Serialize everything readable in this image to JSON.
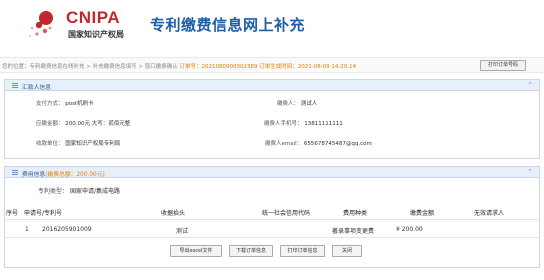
{
  "header": {
    "logo_brand": "CNIPA",
    "logo_sub": "国家知识产权局",
    "page_title": "专利缴费信息网上补充"
  },
  "breadcrumb": {
    "path": "您的位置：专利缴费信息在线补充 > 补充缴费信息填写 > 窗口缴费确认",
    "order_label": "订单号：2021080900302389",
    "time_label": "订单生成时间：2021-08-09 14:20:14",
    "print_order_button": "打印订单号码"
  },
  "remitter": {
    "title": "汇款人信息",
    "payment_method_label": "支付方式：",
    "payment_method_value": "post机刷卡",
    "total_amount_label": "应缴金额：",
    "total_amount_value": "200.00元 大写：贰佰元整",
    "receiving_unit_label": "收款单位：",
    "receiving_unit_value": "国家知识产权局专利局",
    "payer_label": "缴费人：",
    "payer_value": "测试人",
    "payer_phone_label": "缴费人手机号：",
    "payer_phone_value": "13811111111",
    "payer_email_label": "缴费人email：",
    "payer_email_value": "655678745487@qq.com"
  },
  "fees": {
    "title_prefix": "费用信息",
    "title_amount": "(缴费总额：200.00元)",
    "patent_type_label": "专利类型：",
    "patent_type_value": "国家申请/集成电路",
    "columns": [
      "序号",
      "申请号/专利号",
      "收据抬头",
      "统一社会信用代码",
      "费用种类",
      "缴费金额",
      "无效请求人"
    ],
    "rows": [
      [
        "1",
        "2016205901009",
        "测试",
        "",
        "著录事项变更费",
        "¥ 200.00",
        ""
      ]
    ]
  },
  "actions": {
    "export_excel": "导出excel文件",
    "download_order": "下载订单信息",
    "print_order": "打印订单信息",
    "close": "关闭"
  },
  "colors": {
    "title_blue": "#1e5fa8",
    "logo_red": "#c1272d",
    "accent_orange": "#e67e00",
    "panel_head_bg": "#e7f0fa"
  }
}
